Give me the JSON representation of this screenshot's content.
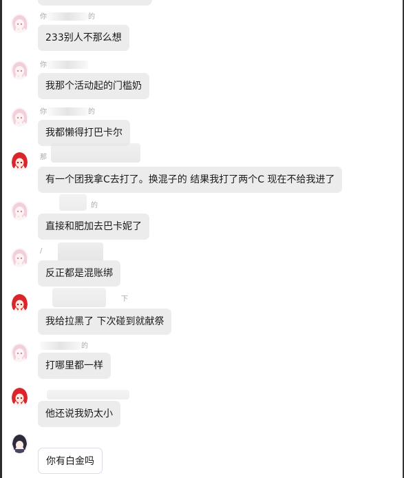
{
  "chat": {
    "messages": [
      {
        "sender_fragment": "你",
        "name_suffix": "的",
        "text": "233别人不那么想",
        "avatar": "pink-hair-avatar"
      },
      {
        "sender_fragment": "你",
        "name_suffix": "",
        "text": "我那个活动起的门槛奶",
        "avatar": "pink-hair-avatar"
      },
      {
        "sender_fragment": "你",
        "name_suffix": "的",
        "text": "我都懒得打巴卡尔",
        "avatar": "pink-hair-avatar"
      },
      {
        "sender_fragment": "那",
        "name_suffix": "",
        "text": "有一个团我拿C去打了。换混子的 结果我打了两个C 现在不给我进了",
        "avatar": "red-hair-avatar"
      },
      {
        "sender_fragment": "",
        "name_suffix": "的",
        "text": "直接和肥加去巴卡妮了",
        "avatar": "pink-hair-avatar"
      },
      {
        "sender_fragment": "/",
        "name_suffix": "",
        "text": "反正都是混账绑",
        "avatar": "pink-hair-avatar"
      },
      {
        "sender_fragment": "",
        "name_suffix": "下",
        "text": "我给拉黑了 下次碰到就献祭",
        "avatar": "red-hair-avatar"
      },
      {
        "sender_fragment": "",
        "name_suffix": "的",
        "text": "打哪里都一样",
        "avatar": "pink-hair-avatar"
      },
      {
        "sender_fragment": "",
        "name_suffix": "",
        "text": "他还说我奶太小",
        "avatar": "red-hair-avatar"
      },
      {
        "sender_fragment": "",
        "name_suffix": "",
        "text": "你有白金吗",
        "avatar": "dark-hair-avatar"
      }
    ]
  },
  "colors": {
    "bubble": "#ececec",
    "text": "#1a1a1a",
    "name": "#a8a8a8",
    "pink_hair": "#f4d6e2",
    "red_hair": "#d9262c",
    "dark_hair": "#2d2a3a"
  }
}
